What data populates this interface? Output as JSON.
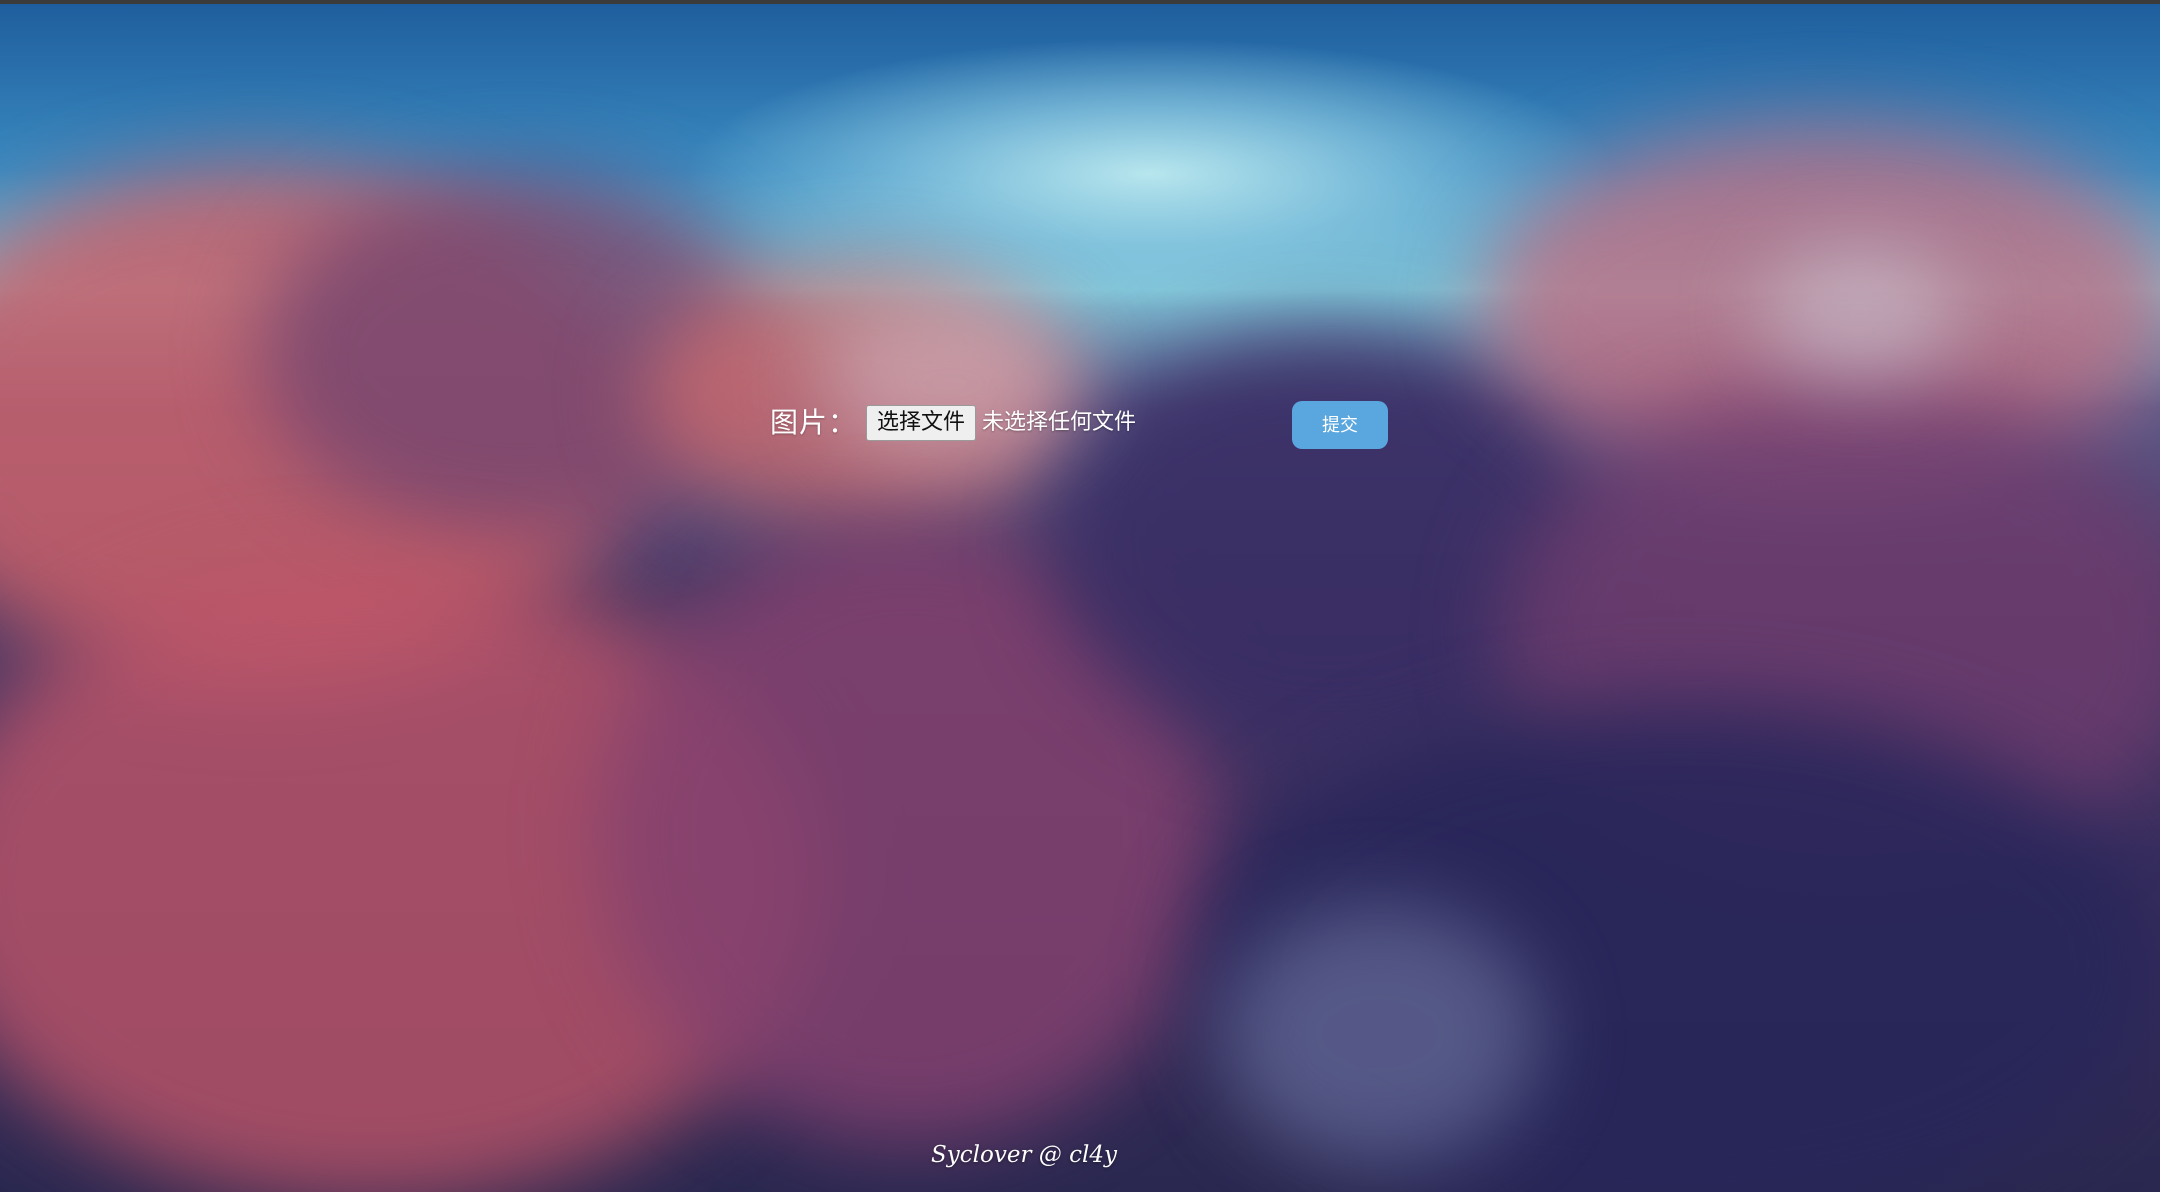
{
  "form": {
    "label": "图片：",
    "file_button_label": "选择文件",
    "file_status": "未选择任何文件",
    "submit_label": "提交"
  },
  "footer": {
    "credit": "Syclover @ cl4y"
  },
  "colors": {
    "submit_button": "#5aa6de",
    "sky_top": "#1f5e9e",
    "cloud_pink": "#c4606a",
    "cloud_dark": "#2a2850"
  }
}
